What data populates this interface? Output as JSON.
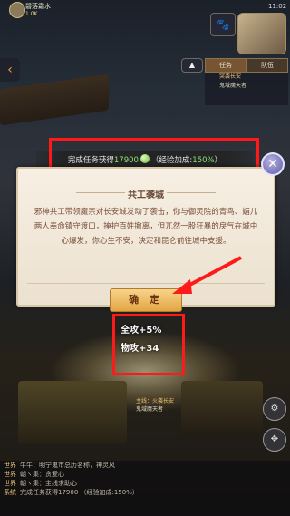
{
  "hud": {
    "player_name": "碧落霜水",
    "level_text": "1.0K",
    "time": "11:02"
  },
  "top_right": {
    "tabs": [
      "任务",
      "队伍"
    ],
    "quest_title": "突袭长安",
    "quest_desc": "鬼域魔天者"
  },
  "banner": {
    "prefix": "完成任务获得",
    "amount": "17900",
    "middle": "（经验加成:",
    "bonus": "150%",
    "suffix": "）"
  },
  "dialog": {
    "title": "共工袭城",
    "body": "邪神共工带领魔宗对长安城发动了袭击，你与御灵院的青鸟、媚儿两人奉命镇守渡口，掩护百姓撤离，但兀然一股狂暴的戾气在城中心爆发，你心生不安，决定和昆仑前往城中支援。",
    "confirm_label": "确 定",
    "close_label": "✕"
  },
  "gain": {
    "line1": "全攻+5%",
    "line2": "物攻+34"
  },
  "mid_task": {
    "line1": "主线：火袭长安",
    "line2": "鬼域魔天者"
  },
  "chat": {
    "lines": [
      {
        "tag": "世界",
        "text": "牛牛：明宁鬼市总历名称，神灵风"
      },
      {
        "tag": "世界",
        "text": "朝ヽ集：贪爱心"
      },
      {
        "tag": "世界",
        "text": "朝ヽ集：主线求助心"
      },
      {
        "tag": "系统",
        "text": "完成任务获得17900 （经验加成:150%）"
      }
    ]
  },
  "colors": {
    "highlight": "#ff1a1a",
    "bonus_green": "#8be07a",
    "dialog_bg": "#f3ebdd",
    "confirm_bg": "#eebc63"
  },
  "icons": [
    "coin-icon",
    "close-icon",
    "arrow-icon",
    "expand-icon",
    "pet-icon",
    "gear-icon"
  ]
}
